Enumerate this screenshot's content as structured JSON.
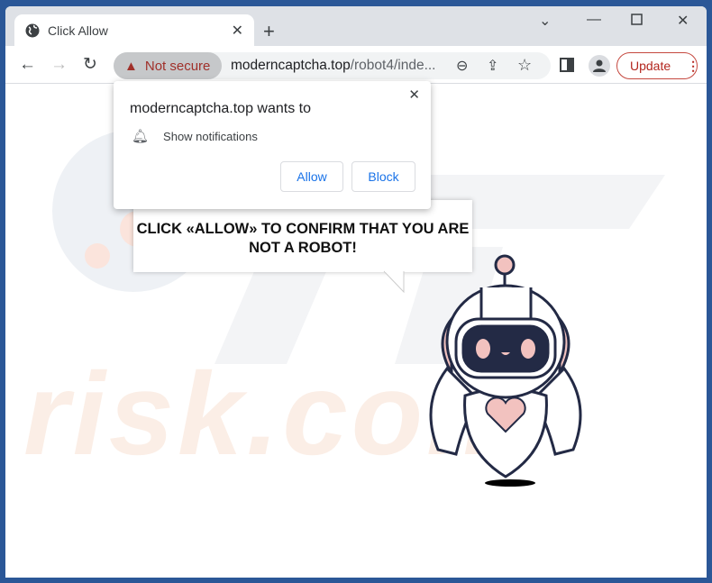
{
  "tab": {
    "title": "Click Allow",
    "icon": "globe-icon"
  },
  "toolbar": {
    "security": "Not secure",
    "url_domain": "moderncaptcha.top",
    "url_path": "/robot4/inde...",
    "update": "Update"
  },
  "popup": {
    "title": "moderncaptcha.top wants to",
    "permission": "Show notifications",
    "allow": "Allow",
    "block": "Block"
  },
  "page": {
    "message": "CLICK «ALLOW» TO CONFIRM THAT YOU ARE NOT A ROBOT!",
    "watermark": "risk.com"
  },
  "colors": {
    "frame": "#2b5797",
    "robot_outline": "#232a45",
    "robot_pink": "#f2c2bf"
  }
}
